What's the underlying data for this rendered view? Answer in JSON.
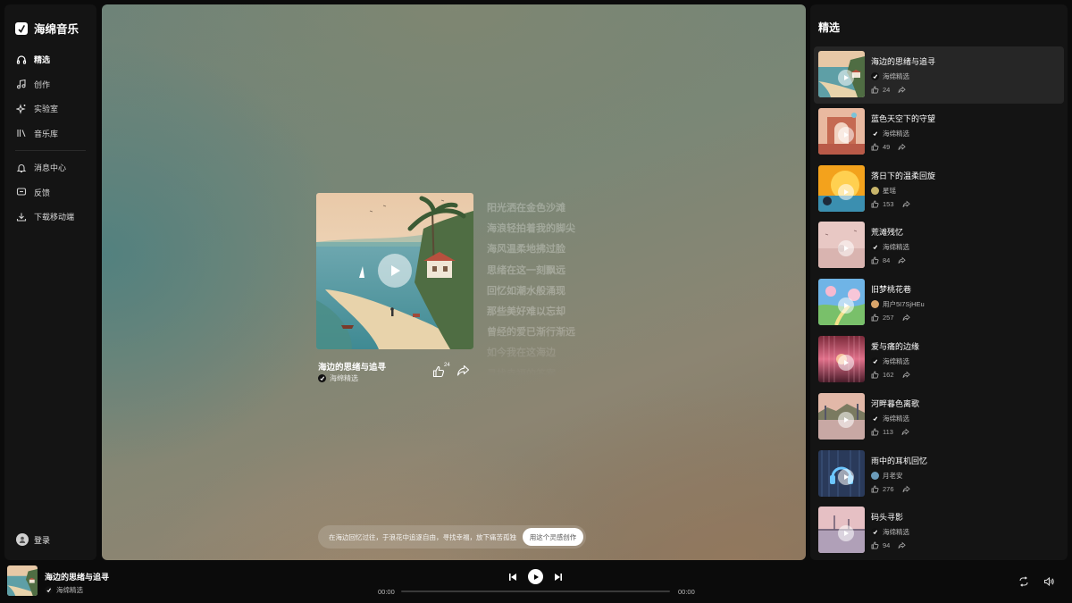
{
  "app": {
    "name": "海绵音乐"
  },
  "sidebar": {
    "items": [
      {
        "label": "精选",
        "icon": "headphones-icon",
        "active": true
      },
      {
        "label": "创作",
        "icon": "music-note-icon"
      },
      {
        "label": "实验室",
        "icon": "sparkle-icon"
      },
      {
        "label": "音乐库",
        "icon": "library-icon"
      }
    ],
    "items2": [
      {
        "label": "消息中心",
        "icon": "bell-icon"
      },
      {
        "label": "反馈",
        "icon": "feedback-icon"
      },
      {
        "label": "下载移动端",
        "icon": "download-icon"
      }
    ],
    "login_label": "登录"
  },
  "now_playing": {
    "title": "海边的思绪与追寻",
    "artist": "海绵精选",
    "likes": "24",
    "lyrics": [
      "阳光洒在金色沙滩",
      "海浪轻拍着我的脚尖",
      "海风温柔地拂过脸",
      "思绪在这一刻飘远",
      "回忆如潮水般涌现",
      "那些美好难以忘却",
      "曾经的爱已渐行渐远",
      "如今我在这海边",
      "寻找幸福的答案"
    ],
    "prompt_text": "在海边回忆过往，于浪花中追逐自由，寻找幸福，放下痛苦孤独",
    "prompt_button": "用这个灵感创作"
  },
  "featured": {
    "title": "精选",
    "items": [
      {
        "title": "海边的思绪与追寻",
        "artist": "海绵精选",
        "likes": "24"
      },
      {
        "title": "蓝色天空下的守望",
        "artist": "海绵精选",
        "likes": "49"
      },
      {
        "title": "落日下的温柔回旋",
        "artist": "星瑶",
        "likes": "153"
      },
      {
        "title": "荒滩残忆",
        "artist": "海绵精选",
        "likes": "84"
      },
      {
        "title": "旧梦桃花巷",
        "artist": "用户5I7SjHEu",
        "likes": "257"
      },
      {
        "title": "爱与痛的边缘",
        "artist": "海绵精选",
        "likes": "162"
      },
      {
        "title": "河畔暮色离歌",
        "artist": "海绵精选",
        "likes": "113"
      },
      {
        "title": "雨中的耳机回忆",
        "artist": "月老安",
        "likes": "276"
      },
      {
        "title": "码头寻影",
        "artist": "海绵精选",
        "likes": "94"
      }
    ]
  },
  "player": {
    "title": "海边的思绪与追寻",
    "artist": "海绵精选",
    "current_time": "00:00",
    "total_time": "00:00",
    "progress": 0
  },
  "colors": {
    "background": "#0b0b0b",
    "panel": "#141414",
    "active_row": "#262626"
  }
}
